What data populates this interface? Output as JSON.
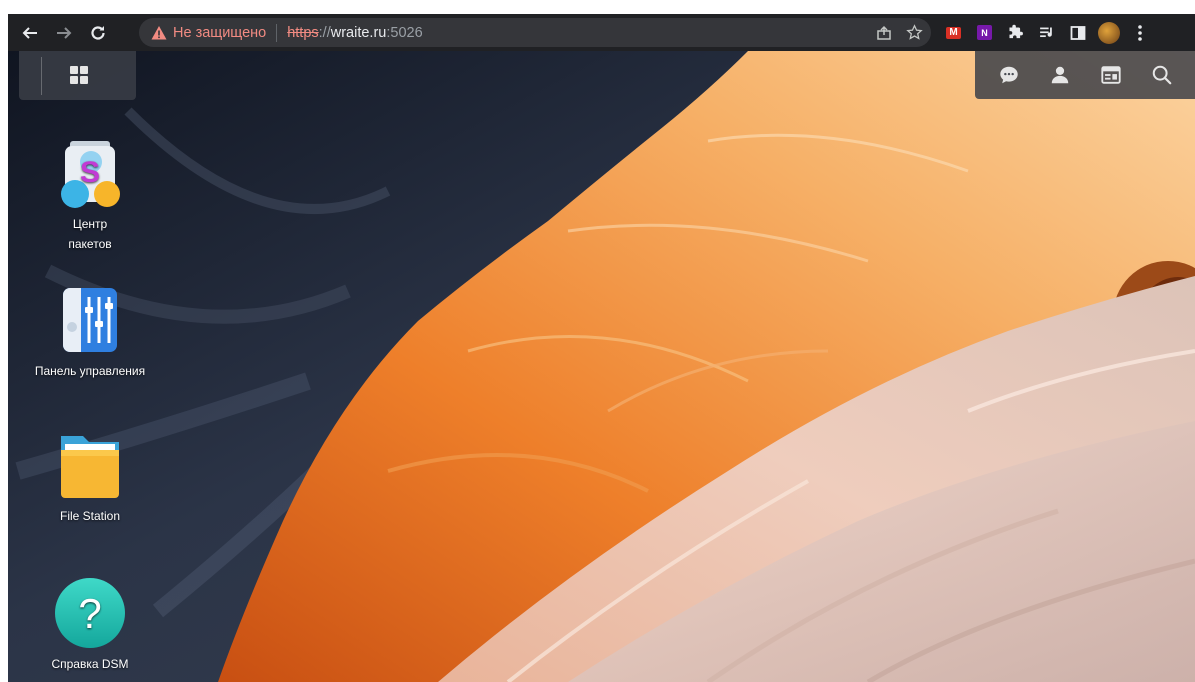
{
  "browser": {
    "nav": {
      "back_icon": "arrow-left-icon",
      "forward_icon": "arrow-right-icon",
      "reload_icon": "reload-icon"
    },
    "address": {
      "security_icon": "warning-triangle-icon",
      "security_text": "Не защищено",
      "scheme": "https",
      "scheme_sep": "://",
      "host": "wraite.ru",
      "port": ":5026"
    },
    "omnibox_actions": [
      "share-icon",
      "bookmark-star-icon"
    ],
    "extensions": [
      "gmail-extension-icon",
      "onenote-extension-icon",
      "puzzle-extensions-icon",
      "reading-list-icon",
      "side-panel-icon",
      "profile-avatar",
      "kebab-menu-icon"
    ],
    "colors": {
      "chrome_bg": "#202124",
      "omnibox_bg": "#35363a",
      "insecure_red": "#f28b82"
    }
  },
  "dsm": {
    "taskbar_left": {
      "main_menu_icon": "grid-menu-icon"
    },
    "taskbar_right": [
      "chat-bubble-icon",
      "user-icon",
      "widgets-icon",
      "search-icon"
    ],
    "desktop_icons": [
      {
        "name": "package-center",
        "label_line1": "Центр",
        "label_line2": "пакетов",
        "icon": "package-center-icon"
      },
      {
        "name": "control-panel",
        "label_line1": "Панель управления",
        "label_line2": "",
        "icon": "control-panel-icon"
      },
      {
        "name": "file-station",
        "label_line1": "File Station",
        "label_line2": "",
        "icon": "folder-icon"
      },
      {
        "name": "dsm-help",
        "label_line1": "Справка DSM",
        "label_line2": "",
        "icon": "help-question-icon"
      }
    ],
    "wallpaper": {
      "subject": "sandstone canyon",
      "colors": [
        "#141a26",
        "#e07a2e",
        "#f0c38c",
        "#e9d4c6"
      ]
    }
  }
}
